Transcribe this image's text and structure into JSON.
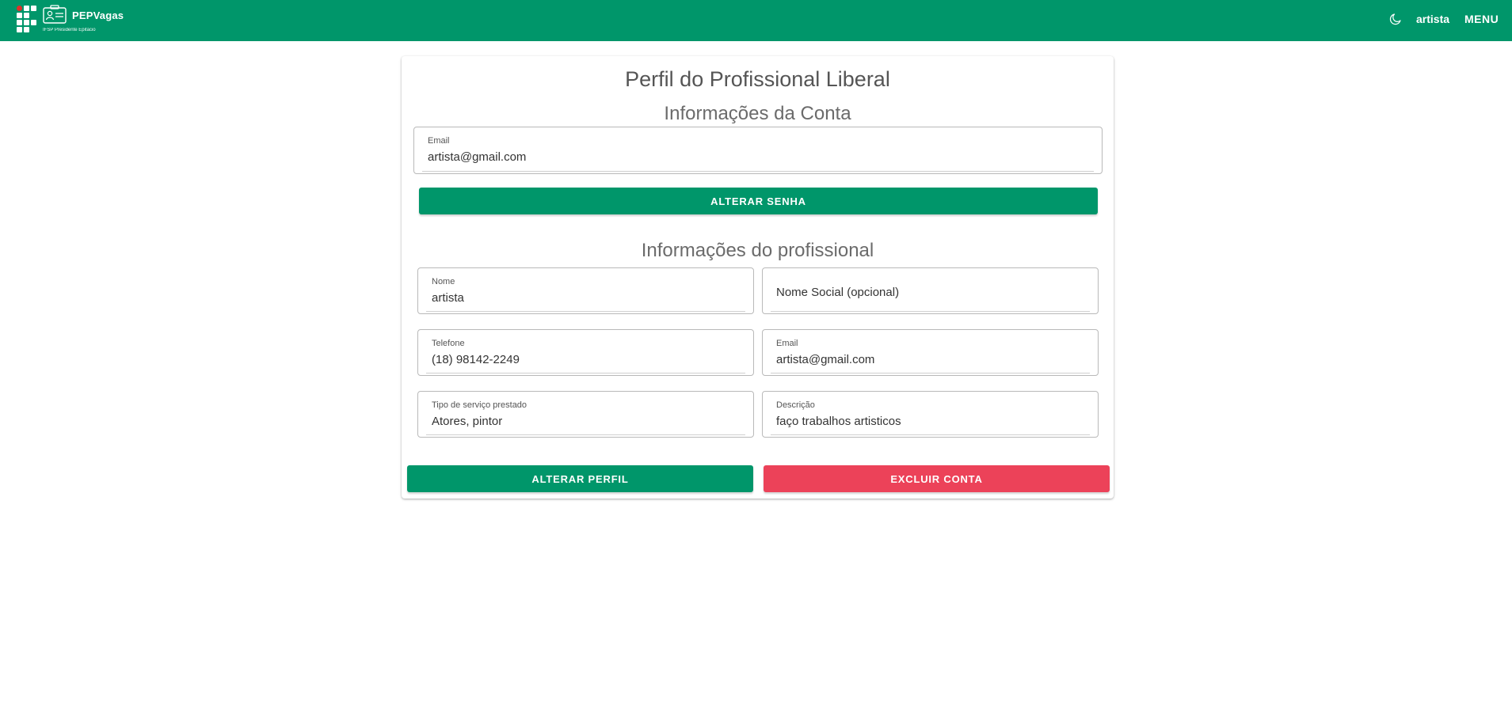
{
  "header": {
    "brand": "PEPVagas",
    "subtitle": "IFSP Presidente Epitácio",
    "user": "artista",
    "menu_label": "MENU"
  },
  "icons": {
    "logo": "ifsp-logo-icon",
    "brand": "id-card-icon",
    "theme": "moon-icon"
  },
  "colors": {
    "primary": "#00966a",
    "danger": "#ec4259"
  },
  "page": {
    "title": "Perfil do Profissional Liberal",
    "account_section": "Informações da Conta",
    "account_email_label": "Email",
    "account_email_value": "artista@gmail.com",
    "change_password_label": "ALTERAR SENHA",
    "professional_section": "Informações do profissional",
    "fields": {
      "name_label": "Nome",
      "name_value": "artista",
      "social_name_placeholder": "Nome Social (opcional)",
      "phone_label": "Telefone",
      "phone_value": "(18) 98142-2249",
      "email_label": "Email",
      "email_value": "artista@gmail.com",
      "service_label": "Tipo de serviço prestado",
      "service_value": "Atores, pintor",
      "description_label": "Descrição",
      "description_value": "faço trabalhos artisticos"
    },
    "update_profile_label": "ALTERAR PERFIL",
    "delete_account_label": "EXCLUIR CONTA"
  }
}
